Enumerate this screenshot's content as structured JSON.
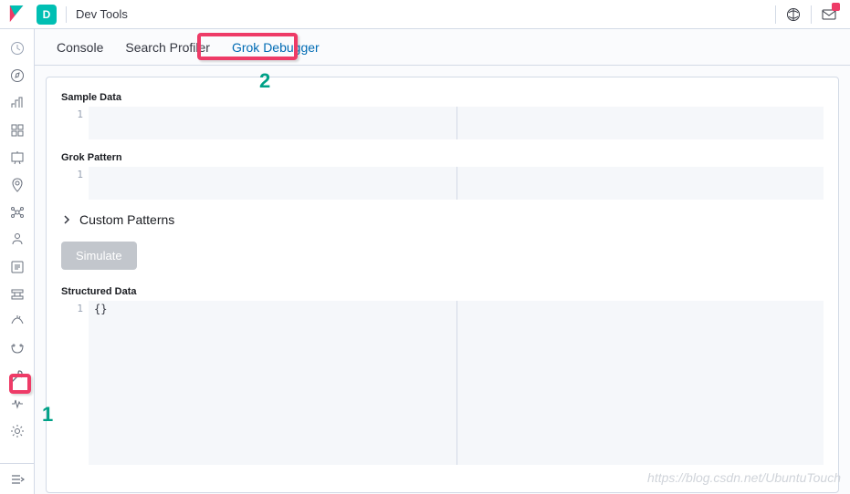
{
  "header": {
    "space_letter": "D",
    "title": "Dev Tools"
  },
  "tabs": [
    {
      "label": "Console",
      "selected": false
    },
    {
      "label": "Search Profiler",
      "selected": false
    },
    {
      "label": "Grok Debugger",
      "selected": true
    }
  ],
  "panel": {
    "sample_data_label": "Sample Data",
    "sample_data_line": "1",
    "grok_pattern_label": "Grok Pattern",
    "grok_pattern_line": "1",
    "custom_patterns_label": "Custom Patterns",
    "simulate_label": "Simulate",
    "structured_data_label": "Structured Data",
    "structured_data_line": "1",
    "structured_data_value": "{}"
  },
  "nav_icons": [
    "recent-icon",
    "discover-icon",
    "visualize-icon",
    "dashboard-icon",
    "canvas-icon",
    "maps-icon",
    "ml-icon",
    "infrastructure-icon",
    "logs-icon",
    "apm-icon",
    "uptime-icon",
    "siem-icon",
    "devtools-icon",
    "monitoring-icon",
    "management-icon"
  ],
  "annotations": {
    "num1": "1",
    "num2": "2"
  },
  "watermark": "https://blog.csdn.net/UbuntuTouch"
}
